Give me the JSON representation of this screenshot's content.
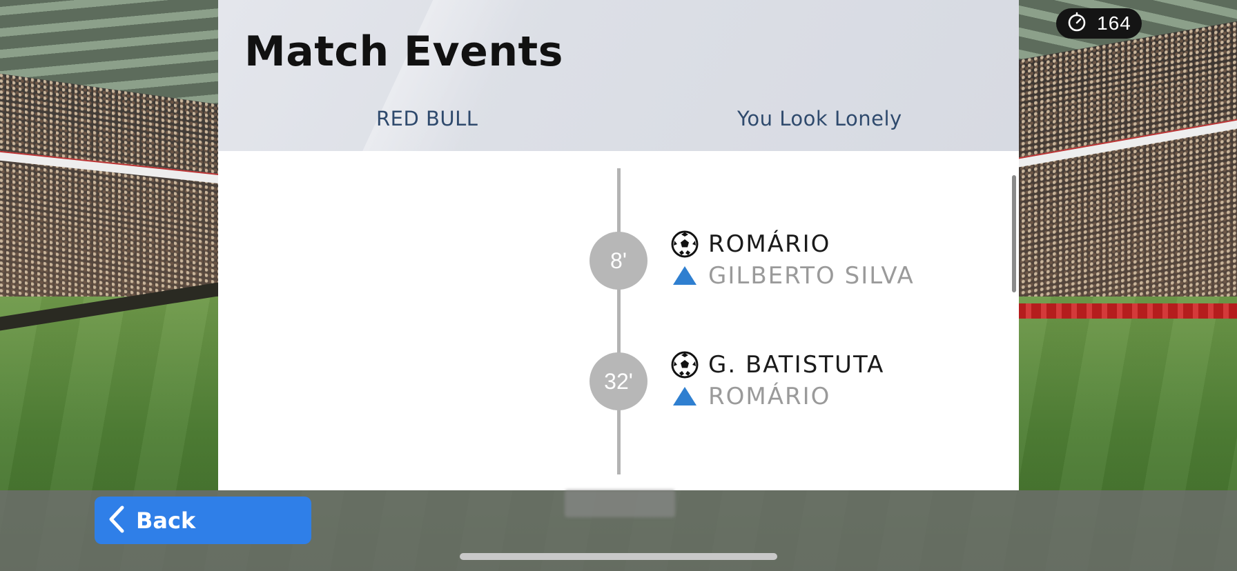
{
  "timer": {
    "icon": "stopwatch-icon",
    "value": "164"
  },
  "panel": {
    "title": "Match Events",
    "teams": {
      "home": "RED BULL",
      "away": "You Look Lonely"
    }
  },
  "events": [
    {
      "minute": "8'",
      "scorer": "ROMÁRIO",
      "assist": "GILBERTO SILVA",
      "side": "away"
    },
    {
      "minute": "32'",
      "scorer": "G. BATISTUTA",
      "assist": "ROMÁRIO",
      "side": "away"
    }
  ],
  "footer": {
    "back_label": "Back",
    "back_icon": "chevron-left-icon"
  },
  "colors": {
    "accent": "#2f7fe8",
    "team_name": "#2f4a6d",
    "minute_badge": "#b7b7b7",
    "assist_icon": "#2f7fd0"
  }
}
